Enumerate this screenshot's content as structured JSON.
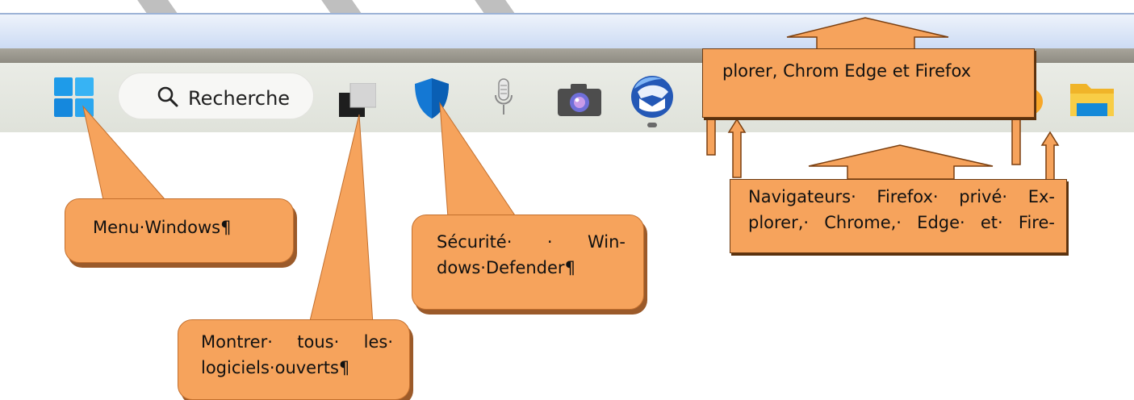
{
  "search": {
    "label": "Recherche"
  },
  "callouts": {
    "menu_windows": "Menu·Windows¶",
    "montrer": {
      "line1_words": [
        "Montrer·",
        "tous·",
        "les·"
      ],
      "line2": "logiciels·ouverts¶"
    },
    "securite": {
      "line1_words": [
        "Sécurité·",
        "·",
        "Win-"
      ],
      "line2": "dows·Defender¶"
    },
    "navigateurs": {
      "line1_words": [
        "Navigateurs·",
        "Firefox·",
        "privé·",
        "Ex-"
      ],
      "line2_words": [
        "plorer,·",
        "Chrome,·",
        "Edge·",
        "et·",
        "Fire-"
      ]
    },
    "top_banner": "plorer, Chrom Edge et Firefox"
  },
  "taskbar_icons": [
    "windows-start-icon",
    "task-view-icon",
    "windows-defender-icon",
    "microphone-icon",
    "camera-icon",
    "thunderbird-icon",
    "firefox-icon",
    "file-explorer-icon"
  ],
  "colors": {
    "callout_fill": "#f6a35c",
    "callout_shadow": "#9b5a2a",
    "taskbar_bg": "#e4e7df",
    "window_blue": "#c9d9f3"
  }
}
